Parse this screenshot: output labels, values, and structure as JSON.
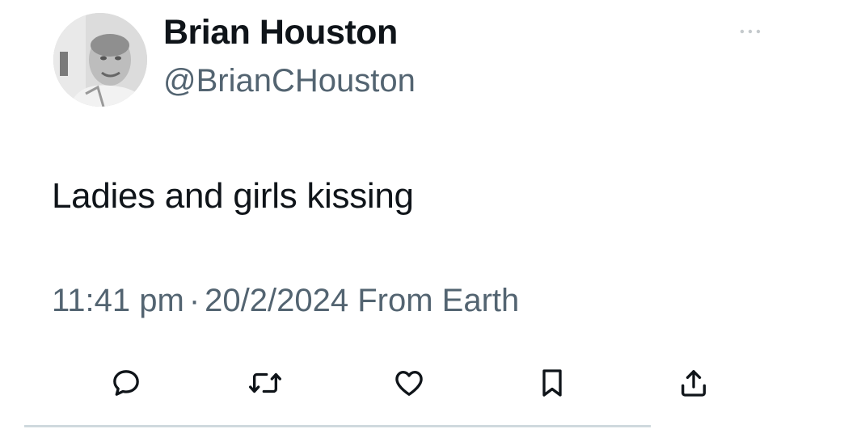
{
  "tweet": {
    "author": {
      "display_name": "Brian Houston",
      "handle": "@BrianCHouston"
    },
    "text": "Ladies and girls kissing",
    "time": "11:41 pm",
    "separator": "·",
    "date": "20/2/2024",
    "source": "From Earth"
  },
  "actions": {
    "reply_icon": "speech-bubble-icon",
    "retweet_icon": "retweet-arrows-icon",
    "like_icon": "heart-icon",
    "bookmark_icon": "bookmark-icon",
    "share_icon": "share-upload-icon"
  },
  "colors": {
    "primary_text": "#0f1419",
    "secondary_text": "#536471",
    "icon": "#536471",
    "background": "#ffffff"
  }
}
